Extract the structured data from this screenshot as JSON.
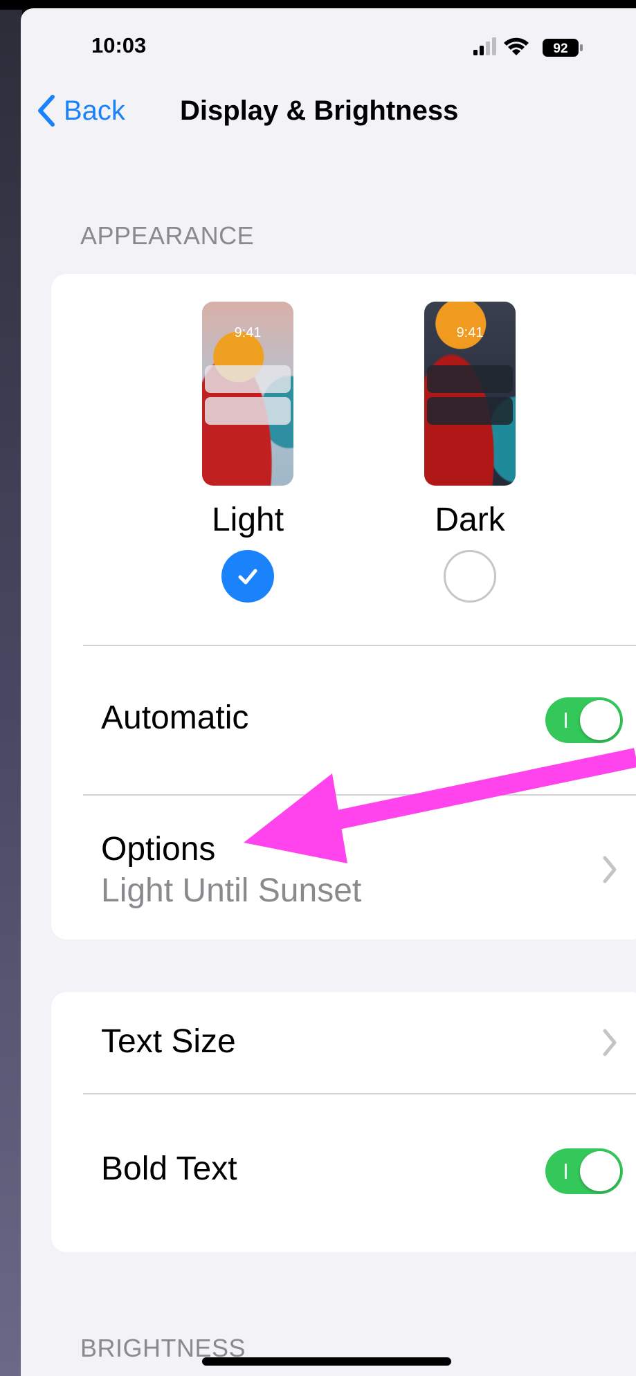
{
  "status_bar": {
    "time": "10:03",
    "battery": "92"
  },
  "nav": {
    "back_label": "Back",
    "title": "Display & Brightness"
  },
  "appearance": {
    "header": "APPEARANCE",
    "light": {
      "label": "Light",
      "preview_time": "9:41",
      "selected": true
    },
    "dark": {
      "label": "Dark",
      "preview_time": "9:41",
      "selected": false
    },
    "automatic": {
      "label": "Automatic",
      "on": true
    },
    "options": {
      "label": "Options",
      "value": "Light Until Sunset"
    }
  },
  "text": {
    "text_size": {
      "label": "Text Size"
    },
    "bold_text": {
      "label": "Bold Text",
      "on": true
    }
  },
  "brightness": {
    "header": "BRIGHTNESS"
  },
  "annotation": {
    "arrow_color": "#ff44ee"
  },
  "colors": {
    "accent": "#1a82fb",
    "toggle_on": "#34c759"
  }
}
